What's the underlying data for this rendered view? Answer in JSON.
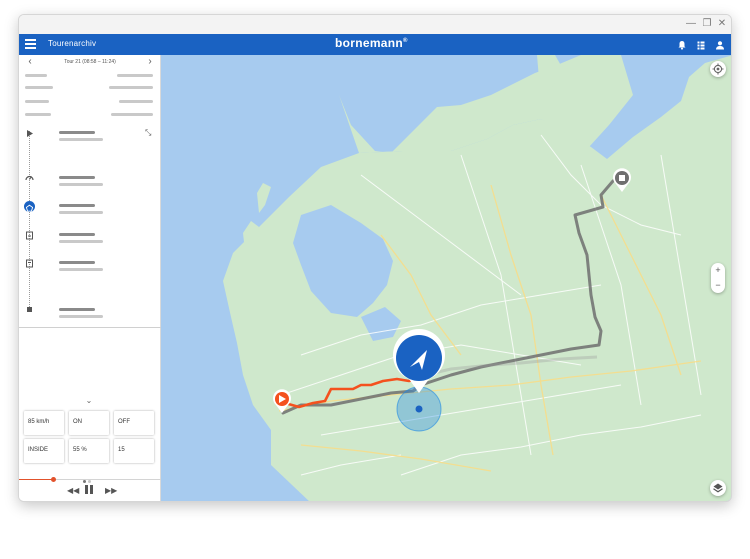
{
  "app": {
    "title": "Tourenarchiv",
    "brand": "bornemann",
    "brand_mark": "®"
  },
  "window_controls": {
    "minimize": "—",
    "maximize": "❐",
    "close": "✕"
  },
  "tour": {
    "label": "Tour 21 (08:58 – 11:24)",
    "prev_icon": "‹",
    "next_icon": "›",
    "expand_icon": "⤡"
  },
  "timeline_icons": [
    "play-icon",
    "gauge-icon",
    "stop-circle-icon",
    "document-icon",
    "document-icon",
    "square-icon"
  ],
  "collapse_icon": "⌄",
  "stats": [
    {
      "value": "85 km/h"
    },
    {
      "value": "ON"
    },
    {
      "value": "OFF"
    },
    {
      "value": "INSIDE"
    },
    {
      "value": "55 %"
    },
    {
      "value": "15"
    }
  ],
  "playback": {
    "progress": 0.24,
    "rewind_icon": "◀◀",
    "forward_icon": "▶▶"
  },
  "map": {
    "zoom_in": "+",
    "zoom_out": "−"
  },
  "colors": {
    "appbar": "#1a62c2",
    "route_traveled": "#f4511e",
    "route_planned": "#707070",
    "vehicle_marker": "#1a62c2",
    "start_marker": "#f4511e",
    "end_marker": "#6f6f6f",
    "water": "#a7cbef",
    "land": "#cfe8cc"
  }
}
